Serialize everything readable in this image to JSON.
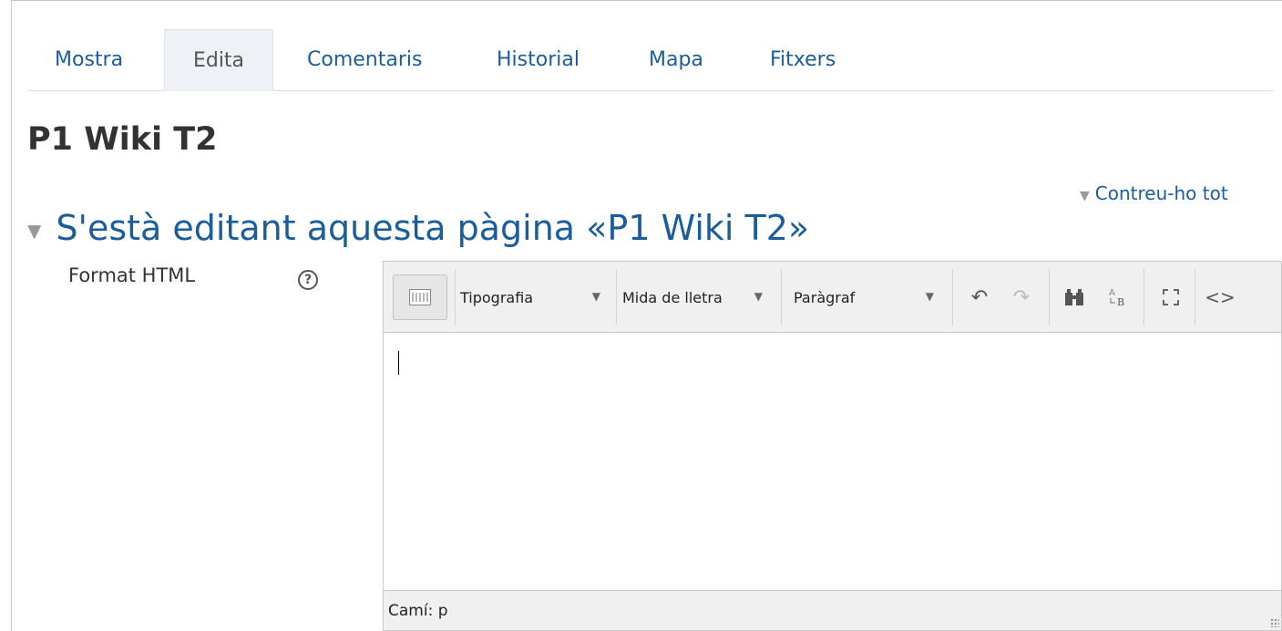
{
  "tabs": [
    {
      "label": "Mostra",
      "active": false
    },
    {
      "label": "Edita",
      "active": true
    },
    {
      "label": "Comentaris",
      "active": false
    },
    {
      "label": "Historial",
      "active": false
    },
    {
      "label": "Mapa",
      "active": false
    },
    {
      "label": "Fitxers",
      "active": false
    }
  ],
  "page_title": "P1 Wiki T2",
  "collapse_all": "Contreu-ho tot",
  "section_title": "S'està editant aquesta pàgina «P1 Wiki T2»",
  "format_label": "Format HTML",
  "help_icon": "question-circle-icon",
  "editor": {
    "toolbar": {
      "font_family": "Tipografia",
      "font_size": "Mida de lletra",
      "paragraph": "Paràgraf",
      "icons": [
        "keyboard-icon",
        "undo-icon",
        "redo-icon",
        "find-icon",
        "spellcheck-icon",
        "fullscreen-icon",
        "html-source-icon"
      ]
    },
    "path_label": "Camí: p"
  },
  "colors": {
    "link": "#1a5d9c",
    "tab_active_bg": "#eef2f6",
    "toolbar_bg": "#f0f0f0"
  }
}
